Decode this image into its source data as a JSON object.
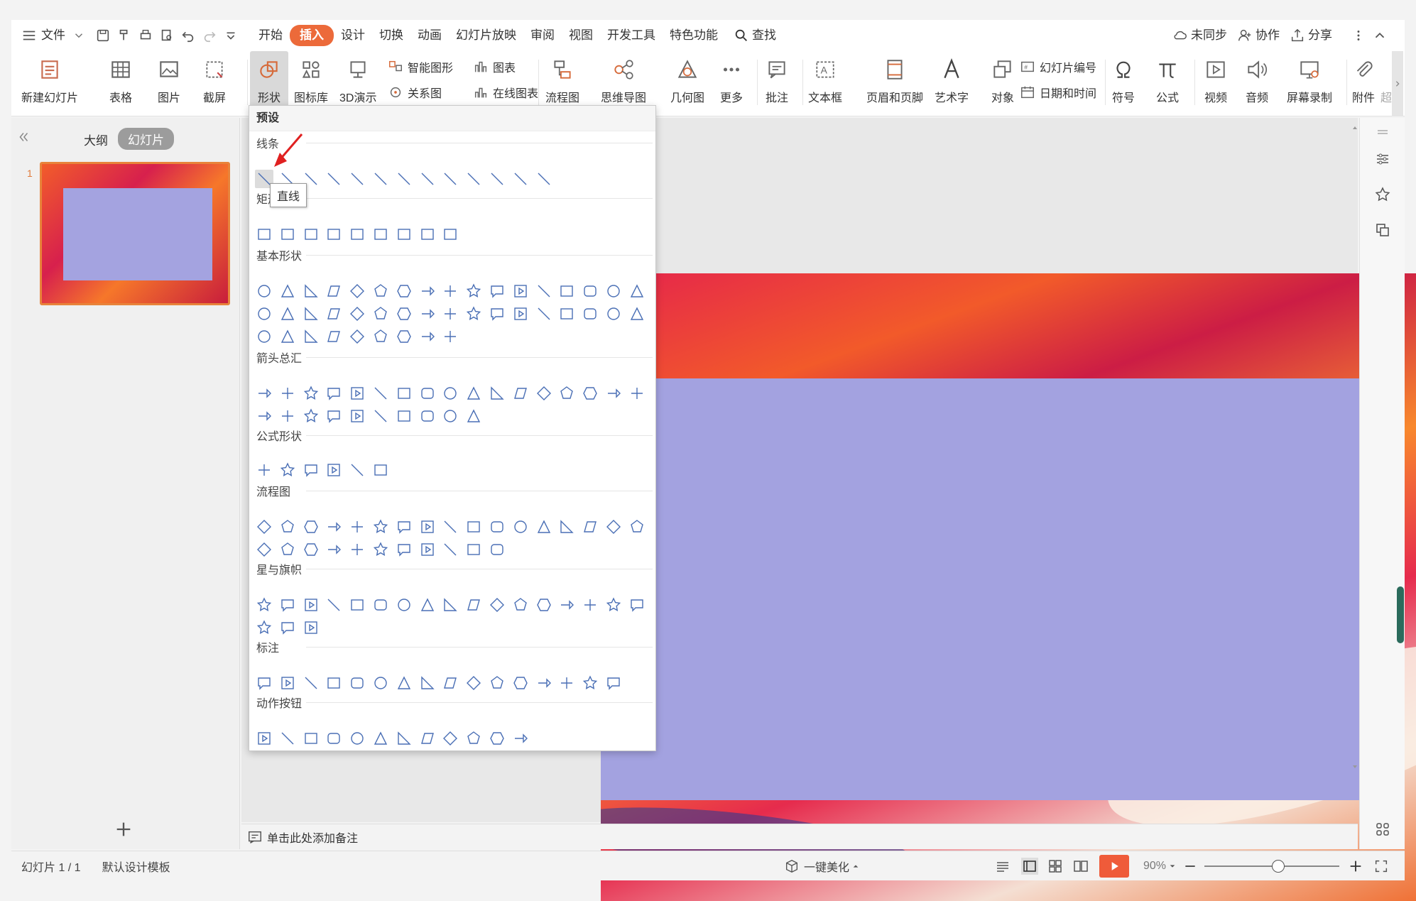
{
  "menubar": {
    "file_label": "文件",
    "tabs": [
      "开始",
      "插入",
      "设计",
      "切换",
      "动画",
      "幻灯片放映",
      "审阅",
      "视图",
      "开发工具",
      "特色功能"
    ],
    "active_tab": "插入",
    "search_label": "查找",
    "right": [
      "未同步",
      "协作",
      "分享"
    ]
  },
  "ribbon": {
    "new_slide": "新建幻灯片",
    "table": "表格",
    "picture": "图片",
    "screenshot": "截屏",
    "shape": "形状",
    "icon_lib": "图标库",
    "demo3d": "3D演示",
    "smart_shape": "智能图形",
    "chart": "图表",
    "relation": "关系图",
    "online_chart": "在线图表",
    "flowchart": "流程图",
    "mindmap": "思维导图",
    "geometry": "几何图",
    "more": "更多",
    "comment": "批注",
    "textbox": "文本框",
    "header_footer": "页眉和页脚",
    "wordart": "艺术字",
    "object": "对象",
    "slide_number": "幻灯片编号",
    "datetime": "日期和时间",
    "symbol": "符号",
    "formula": "公式",
    "video": "视频",
    "audio": "音频",
    "screen_record": "屏幕录制",
    "attachment": "附件",
    "overflow": "超"
  },
  "leftpanel": {
    "outline_tab": "大纲",
    "slides_tab": "幻灯片",
    "slide_number": "1"
  },
  "dropdown": {
    "header": "预设",
    "sections": [
      "线条",
      "矩形",
      "基本形状",
      "箭头总汇",
      "公式形状",
      "流程图",
      "星与旗帜",
      "标注",
      "动作按钮"
    ],
    "tooltip": "直线"
  },
  "notes": {
    "placeholder": "单击此处添加备注"
  },
  "statusbar": {
    "slide_info": "幻灯片 1 / 1",
    "template": "默认设计模板",
    "beautify": "一键美化",
    "zoom": "90%"
  },
  "colors": {
    "accent": "#ec6a3a",
    "shape_stroke": "#4a6fb5",
    "placeholder_fill": "#a3a2e0"
  }
}
